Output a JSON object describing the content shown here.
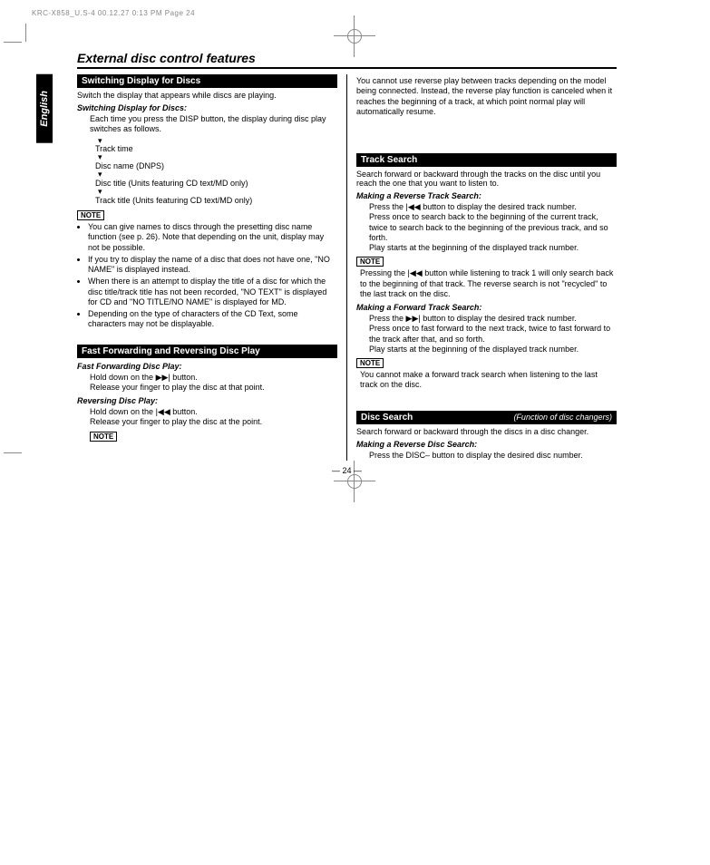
{
  "meta": {
    "header": "KRC-X858_U.S-4  00.12.27 0:13 PM  Page 24",
    "language_tab": "English",
    "page_number": "— 24 —"
  },
  "title": "External disc control features",
  "left": {
    "s1": {
      "heading": "Switching Display for Discs",
      "intro": "Switch the display that appears while discs are playing.",
      "sub1": "Switching Display for Discs:",
      "sub1_body": "Each time you press the DISP button, the display during disc play switches as follows.",
      "flow": {
        "a": "Track time",
        "b": "Disc name (DNPS)",
        "c": "Disc title (Units featuring CD text/MD only)",
        "d": "Track title (Units featuring CD text/MD only)"
      },
      "note": "NOTE",
      "notes": [
        "You can give names to discs through the presetting disc name function  (see p. 26). Note that depending on the unit, display may not be possible.",
        "If you try to display the name of a disc that does not have one, \"NO NAME\" is displayed instead.",
        "When there is an attempt to display the title of a disc for which the disc title/track title has not been recorded, \"NO TEXT\" is displayed for CD and \"NO TITLE/NO NAME\" is displayed for MD.",
        "Depending on the type of characters of the CD Text, some characters may not be displayable."
      ]
    },
    "s2": {
      "heading": "Fast Forwarding and Reversing Disc Play",
      "sub1": "Fast Forwarding Disc Play:",
      "sub1_l1": "Hold down on the ",
      "sub1_l1b": " button.",
      "sub1_l2": "Release your finger to play the disc at that point.",
      "sub2": "Reversing Disc Play:",
      "sub2_l1": "Hold down on the ",
      "sub2_l1b": " button.",
      "sub2_l2": "Release your finger to play the disc at the point.",
      "note": "NOTE"
    }
  },
  "right": {
    "pretext": "You cannot use reverse play between tracks depending on the model being connected. Instead, the reverse play function is canceled when it reaches the beginning of a track, at which point normal play will automatically resume.",
    "s1": {
      "heading": "Track Search",
      "intro": "Search forward or backward through the tracks on the disc until you reach the one that you want to listen to.",
      "sub1": "Making a Reverse Track Search:",
      "sub1_l1a": "Press the ",
      "sub1_l1b": " button to display the desired track number.",
      "sub1_l2": "Press once to search back to the beginning of the current track, twice to search back to the beginning of the previous track, and so forth.",
      "sub1_l3": "Play starts at the beginning of the displayed track number.",
      "note1": "NOTE",
      "note1_l1a": "Pressing the ",
      "note1_l1b": " button while listening to track 1 will only search back to the beginning of that track. The reverse search is not \"recycled\" to the last track on the disc.",
      "sub2": "Making a Forward Track Search:",
      "sub2_l1a": "Press the ",
      "sub2_l1b": " button to display the desired track number.",
      "sub2_l2": "Press once to fast forward to the next track, twice to fast forward to the track after that, and so forth.",
      "sub2_l3": "Play starts at the beginning of the displayed track number.",
      "note2": "NOTE",
      "note2_body": "You cannot make a forward track search when listening to the last track on the disc."
    },
    "s2": {
      "heading": "Disc Search",
      "heading_fn": "(Function of disc changers)",
      "intro": "Search forward or backward through the discs in a disc changer.",
      "sub1": "Making a Reverse Disc Search:",
      "sub1_body": "Press the DISC– button to display the desired disc number."
    }
  }
}
